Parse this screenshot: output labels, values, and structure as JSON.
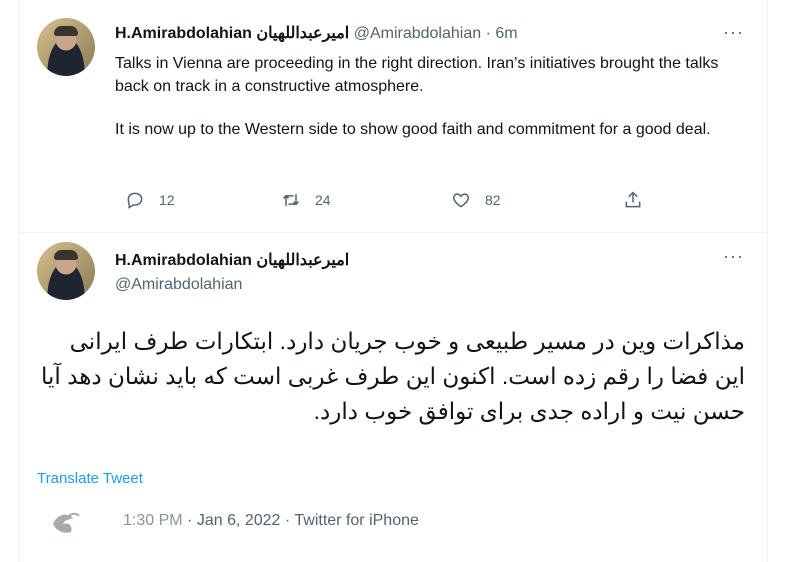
{
  "tweet1": {
    "display_name": "H.Amirabdolahian",
    "display_name_fa": "امیرعبداللهیان",
    "handle": "@Amirabdolahian",
    "separator": "·",
    "time": "6m",
    "paragraphs": [
      "Talks in Vienna are proceeding in the right direction. Iran’s initiatives brought the talks back on track in a constructive atmosphere.",
      "It is now up to the Western side to show good faith and commitment for a good deal."
    ],
    "actions": {
      "replies": "12",
      "retweets": "24",
      "likes": "82"
    }
  },
  "tweet2": {
    "display_name": "H.Amirabdolahian",
    "display_name_fa": "امیرعبداللهیان",
    "handle": "@Amirabdolahian",
    "text": "مذاکرات وین در مسیر طبیعی و خوب جریان دارد. ابتکارات طرف ایرانی این فضا را رقم زده است. اکنون این طرف غربی است که باید نشان دهد آیا حسن نیت و اراده جدی برای توافق خوب دارد.",
    "translate_label": "Translate Tweet",
    "time": "1:30 PM",
    "date": "Jan 6, 2022",
    "source": "Twitter for iPhone"
  },
  "colors": {
    "accent": "#1d9bf0",
    "secondary_text": "#536471",
    "primary_text": "#0f1419"
  },
  "icons": [
    "more-icon",
    "reply-icon",
    "retweet-icon",
    "like-icon",
    "share-icon"
  ]
}
